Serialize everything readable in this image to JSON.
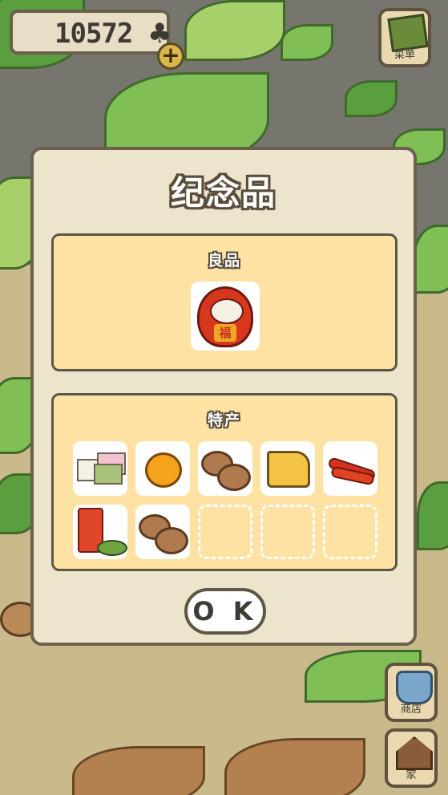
{
  "clover_count": "10572",
  "menu_label": "菜单",
  "shop_label": "商店",
  "home_label": "家",
  "dialog": {
    "title": "纪念品",
    "good_section": {
      "title": "良品",
      "items": [
        "daruma"
      ]
    },
    "specialty_section": {
      "title": "特产",
      "items": [
        "sakura-mochi",
        "mikan-orange",
        "manju-buns",
        "cheese-wedge",
        "red-chili-peppers",
        "tin-and-tea-leaves",
        "manju-buns-2"
      ],
      "empty_slots": 3
    },
    "ok_label": "O K"
  },
  "colors": {
    "panel": "#fde2a4",
    "dialog": "#ede4cc",
    "border": "#5f5647"
  }
}
